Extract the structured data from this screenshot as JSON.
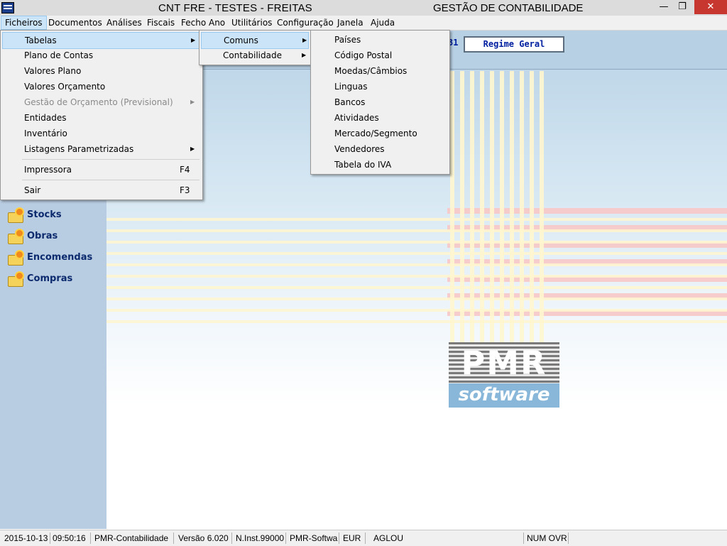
{
  "window": {
    "title_left": "CNT FRE - TESTES - FREITAS",
    "title_right": "GESTÃO DE CONTABILIDADE",
    "min_symbol": "—",
    "max_symbol": "❐",
    "close_symbol": "✕"
  },
  "menubar": {
    "items": [
      "Ficheiros",
      "Documentos",
      "Análises",
      "Fiscais",
      "Fecho Ano",
      "Utilitários",
      "Configuração",
      "Janela",
      "Ajuda"
    ]
  },
  "ficheiros_menu": {
    "items": [
      {
        "label": "Tabelas",
        "submenu": true
      },
      {
        "label": "Plano de Contas"
      },
      {
        "label": "Valores Plano"
      },
      {
        "label": "Valores Orçamento"
      },
      {
        "label": "Gestão de Orçamento (Previsional)",
        "submenu": true,
        "disabled": true
      },
      {
        "label": "Entidades"
      },
      {
        "label": "Inventário"
      },
      {
        "label": "Listagens Parametrizadas",
        "submenu": true
      },
      {
        "label": "Impressora",
        "shortcut": "F4"
      },
      {
        "label": "Sair",
        "shortcut": "F3"
      }
    ]
  },
  "tabelas_menu": {
    "items": [
      {
        "label": "Comuns",
        "submenu": true
      },
      {
        "label": "Contabilidade",
        "submenu": true
      }
    ]
  },
  "comuns_menu": {
    "items": [
      "Países",
      "Código Postal",
      "Moedas/Câmbios",
      "Linguas",
      "Bancos",
      "Atividades",
      "Mercado/Segmento",
      "Vendedores",
      "Tabela do IVA"
    ]
  },
  "header": {
    "regime_prefix": "31",
    "regime_label": "Regime Geral"
  },
  "sidebar": {
    "items": [
      {
        "label": "Stocks",
        "icon": "folder-icon"
      },
      {
        "label": "Obras",
        "icon": "folder-icon"
      },
      {
        "label": "Encomendas",
        "icon": "folder-icon"
      },
      {
        "label": "Compras",
        "icon": "folder-icon"
      }
    ]
  },
  "logo": {
    "pmr": "PMR",
    "software": "software"
  },
  "statusbar": {
    "date": "2015-10-13",
    "time": "09:50:16",
    "product": "PMR-Contabilidade",
    "version": "Versão  6.020",
    "instance": "N.Inst.99000",
    "vendor": "PMR-Softwa",
    "currency": "EUR",
    "user": "AGLOU",
    "keys": "NUM OVR"
  },
  "colors": {
    "menu_highlight": "#cce4f7",
    "sidebar": "#b9cde2",
    "sidebar_text": "#0c2a6e",
    "close_button": "#c7372f"
  }
}
